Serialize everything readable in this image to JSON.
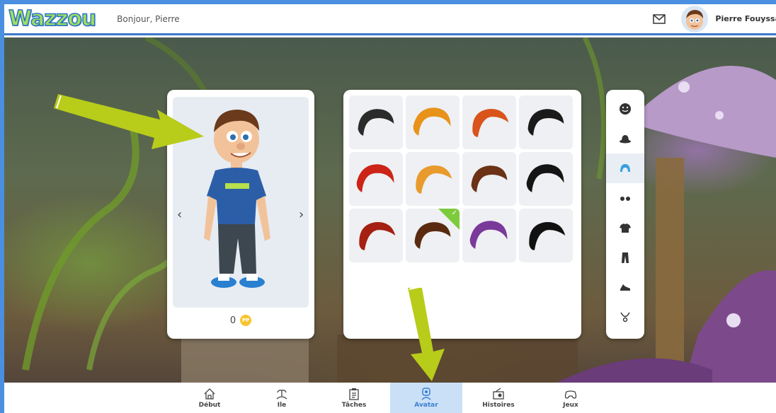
{
  "header": {
    "logo_text": "Wazzou",
    "greeting": "Bonjour, Pierre",
    "user_name": "Pierre Fouyssa",
    "mail_icon": "mail-icon"
  },
  "avatar_card": {
    "prev_label": "‹",
    "next_label": "›",
    "coins_value": "0",
    "coin_label": "PP"
  },
  "items": {
    "category": "hair",
    "selected_index": 9,
    "hair_colors": [
      "#2b2b2b",
      "#e8921a",
      "#d9541b",
      "#1a1a1a",
      "#cc2416",
      "#e99a2c",
      "#6b3216",
      "#151515",
      "#a52012",
      "#5a2a10",
      "#7a3a9a",
      "#111111"
    ]
  },
  "categories": [
    {
      "name": "face-icon",
      "active": false
    },
    {
      "name": "hat-icon",
      "active": false
    },
    {
      "name": "hair-icon",
      "active": true
    },
    {
      "name": "glasses-icon",
      "active": false
    },
    {
      "name": "shirt-icon",
      "active": false
    },
    {
      "name": "pants-icon",
      "active": false
    },
    {
      "name": "shoe-icon",
      "active": false
    },
    {
      "name": "necklace-icon",
      "active": false
    }
  ],
  "bottom_nav": [
    {
      "label": "Début",
      "icon": "home-icon",
      "active": false
    },
    {
      "label": "Ile",
      "icon": "island-icon",
      "active": false
    },
    {
      "label": "Tâches",
      "icon": "clipboard-icon",
      "active": false
    },
    {
      "label": "Avatar",
      "icon": "avatar-icon",
      "active": true
    },
    {
      "label": "Histoires",
      "icon": "radio-icon",
      "active": false
    },
    {
      "label": "Jeux",
      "icon": "gamepad-icon",
      "active": false
    }
  ],
  "colors": {
    "accent": "#3b7fd0",
    "arrow": "#b8cc1a",
    "selected": "#7ccb3d"
  }
}
